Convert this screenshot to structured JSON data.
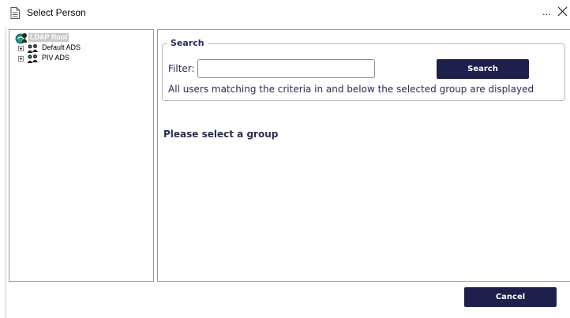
{
  "window": {
    "title": "Select Person",
    "more_label": "...",
    "icons": {
      "title": "document-icon",
      "close": "close-icon"
    }
  },
  "tree": {
    "root": {
      "label": "LDAP Root",
      "icon": "ldap-root-icon"
    },
    "children": [
      {
        "label": "Default ADS",
        "icon": "people-group-icon"
      },
      {
        "label": "PIV ADS",
        "icon": "people-group-icon"
      }
    ]
  },
  "search": {
    "legend": "Search",
    "filter_label": "Filter:",
    "filter_value": "",
    "filter_placeholder": "",
    "button_label": "Search",
    "criteria_note": "All users matching the criteria in and below the selected group are displayed"
  },
  "results": {
    "message": "Please select a group"
  },
  "footer": {
    "cancel_label": "Cancel"
  },
  "colors": {
    "button_bg": "#1f1f4c",
    "button_text": "#ffffff",
    "label_text": "#2b2b52",
    "border": "#9a9a9a",
    "root_highlight": "#c9c9c9"
  }
}
